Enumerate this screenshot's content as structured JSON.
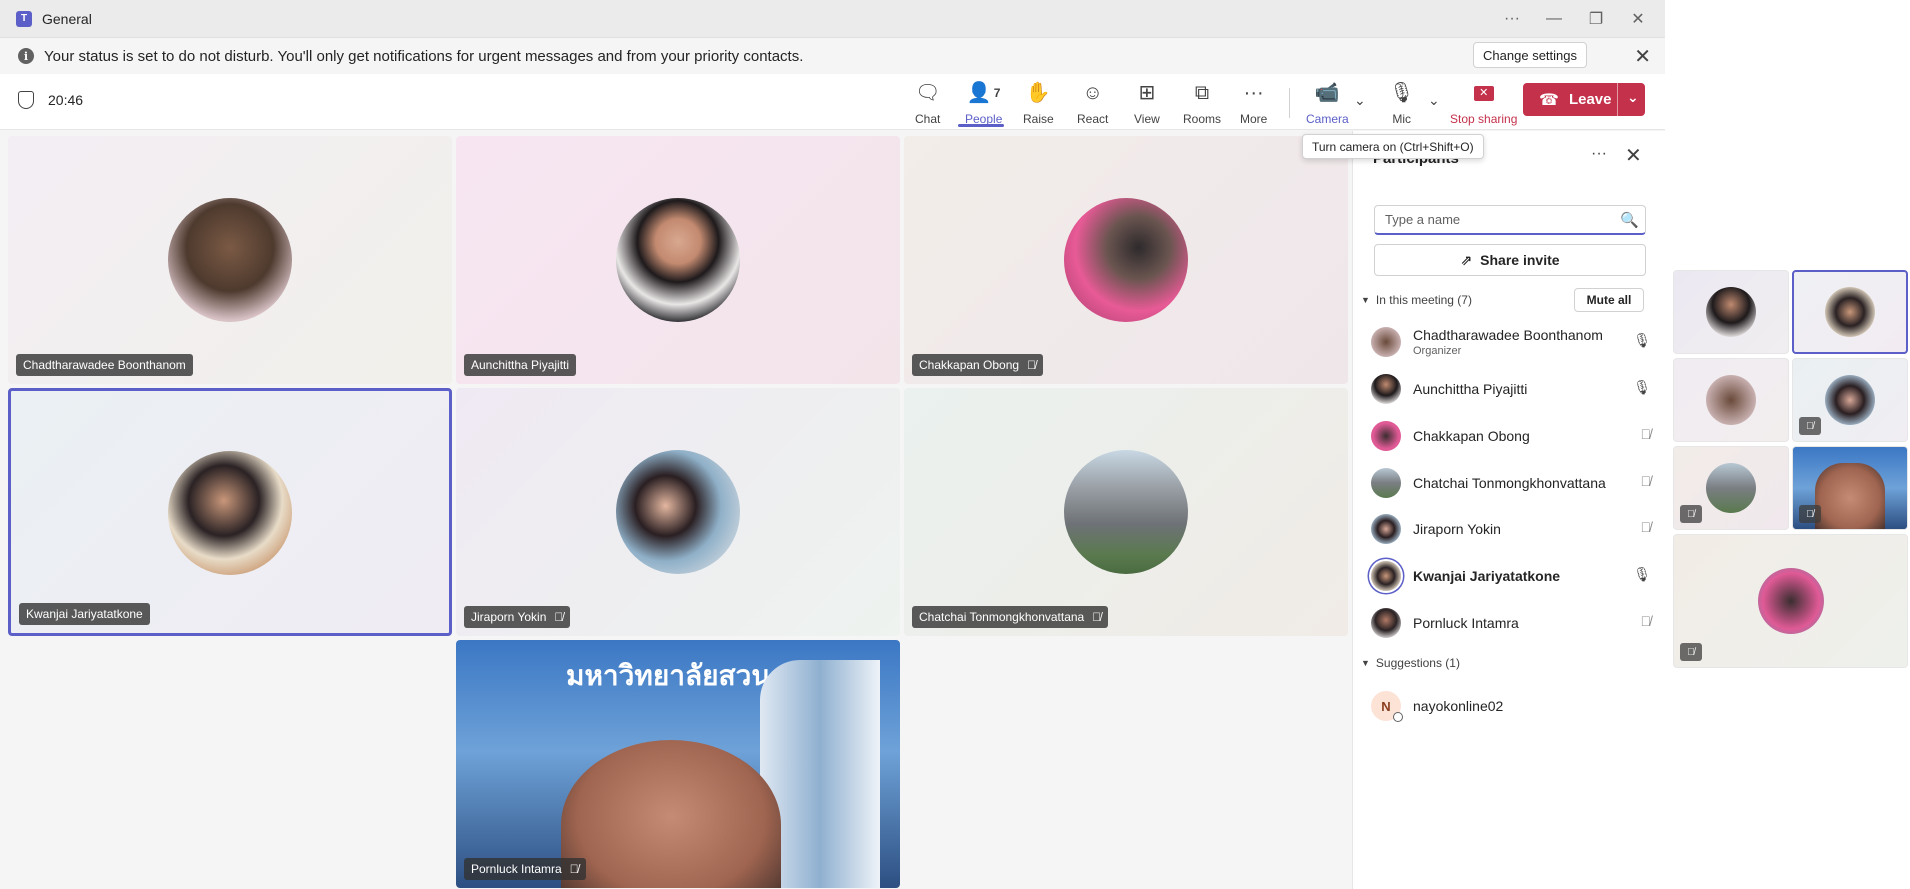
{
  "window": {
    "title": "General"
  },
  "banner": {
    "message": "Your status is set to do not disturb. You'll only get notifications for urgent messages and from your priority contacts.",
    "change_settings": "Change settings"
  },
  "toolbar": {
    "timer": "20:46",
    "chat": "Chat",
    "people": "People",
    "people_count": "7",
    "raise": "Raise",
    "react": "React",
    "view": "View",
    "rooms": "Rooms",
    "more": "More",
    "camera": "Camera",
    "mic": "Mic",
    "stop_sharing": "Stop sharing",
    "leave": "Leave"
  },
  "tooltip": "Turn camera on (Ctrl+Shift+O)",
  "stage": {
    "tiles": [
      {
        "name": "Chadtharawadee Boonthanom",
        "muted": false
      },
      {
        "name": "Aunchittha Piyajitti",
        "muted": false
      },
      {
        "name": "Chakkapan Obong",
        "muted": true
      },
      {
        "name": "Kwanjai Jariyatatkone",
        "muted": false
      },
      {
        "name": "Jiraporn Yokin",
        "muted": true
      },
      {
        "name": "Chatchai Tonmongkhonvattana",
        "muted": true
      },
      {
        "name": "Pornluck Intamra",
        "muted": true
      }
    ],
    "video_banner_text": "มหาวิทยาลัยสวนดุสิต"
  },
  "participants_panel": {
    "title": "Participants",
    "search_placeholder": "Type a name",
    "share_invite": "Share invite",
    "in_meeting_header": "In this meeting (7)",
    "mute_all": "Mute all",
    "people": [
      {
        "name": "Chadtharawadee Boonthanom",
        "role": "Organizer",
        "mic": "on"
      },
      {
        "name": "Aunchittha Piyajitti",
        "role": "",
        "mic": "on"
      },
      {
        "name": "Chakkapan Obong",
        "role": "",
        "mic": "off"
      },
      {
        "name": "Chatchai Tonmongkhonvattana",
        "role": "",
        "mic": "off"
      },
      {
        "name": "Jiraporn Yokin",
        "role": "",
        "mic": "off"
      },
      {
        "name": "Kwanjai Jariyatatkone",
        "role": "",
        "mic": "on"
      },
      {
        "name": "Pornluck Intamra",
        "role": "",
        "mic": "off"
      }
    ],
    "suggestions_header": "Suggestions (1)",
    "suggestions": [
      {
        "initial": "N",
        "name": "nayokonline02"
      }
    ]
  },
  "colors": {
    "accent": "#5b5fc7",
    "leave": "#c4314b"
  }
}
